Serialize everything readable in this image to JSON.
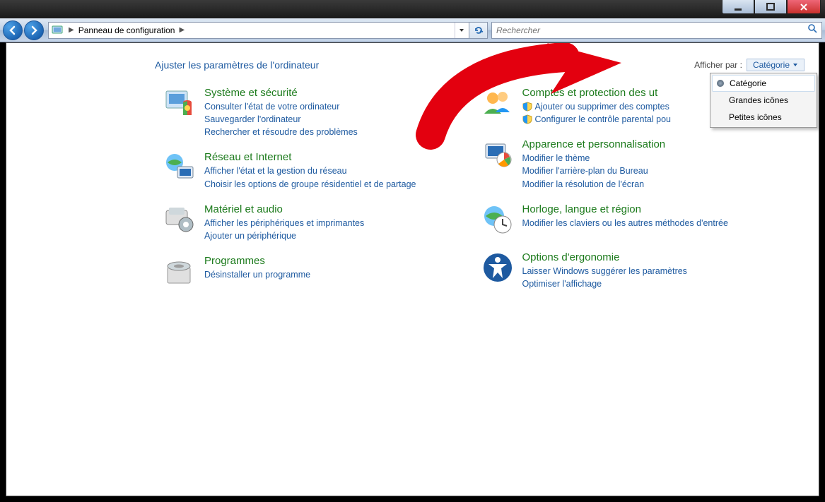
{
  "breadcrumb": {
    "root_label": "Panneau de configuration"
  },
  "search": {
    "placeholder": "Rechercher"
  },
  "heading": "Ajuster les paramètres de l'ordinateur",
  "viewby": {
    "label": "Afficher par :",
    "current": "Catégorie"
  },
  "dropdown": {
    "opt_category": "Catégorie",
    "opt_large": "Grandes icônes",
    "opt_small": "Petites icônes"
  },
  "left": {
    "c1": {
      "title": "Système et sécurité",
      "l1": "Consulter l'état de votre ordinateur",
      "l2": "Sauvegarder l'ordinateur",
      "l3": "Rechercher et résoudre des problèmes"
    },
    "c2": {
      "title": "Réseau et Internet",
      "l1": "Afficher l'état et la gestion du réseau",
      "l2": "Choisir les options de groupe résidentiel et de partage"
    },
    "c3": {
      "title": "Matériel et audio",
      "l1": "Afficher les périphériques et imprimantes",
      "l2": "Ajouter un périphérique"
    },
    "c4": {
      "title": "Programmes",
      "l1": "Désinstaller un programme"
    }
  },
  "right": {
    "c1": {
      "title": "Comptes et protection des ut",
      "l1": "Ajouter ou supprimer des comptes",
      "l2": "Configurer le contrôle parental pou"
    },
    "c2": {
      "title": "Apparence et personnalisation",
      "l1": "Modifier le thème",
      "l2": "Modifier l'arrière-plan du Bureau",
      "l3": "Modifier la résolution de l'écran"
    },
    "c3": {
      "title": "Horloge, langue et région",
      "l1": "Modifier les claviers ou les autres méthodes d'entrée"
    },
    "c4": {
      "title": "Options d'ergonomie",
      "l1": "Laisser Windows suggérer les paramètres",
      "l2": "Optimiser l'affichage"
    }
  }
}
